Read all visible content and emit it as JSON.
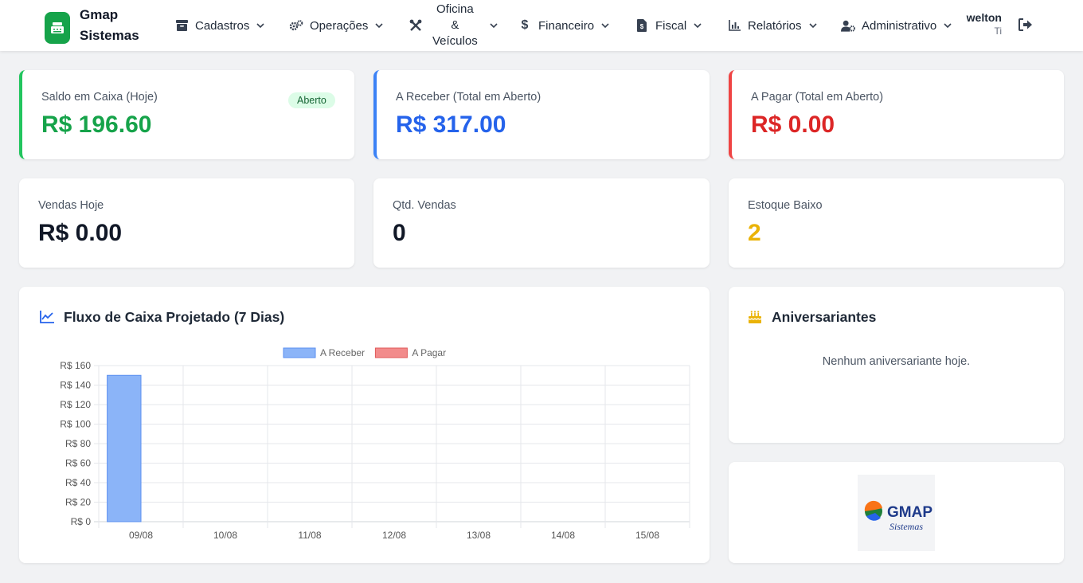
{
  "brand": {
    "name_line1": "Gmap",
    "name_line2": "Sistemas",
    "color": "#16a34a"
  },
  "nav": {
    "cadastros": "Cadastros",
    "operacoes": "Operações",
    "oficina_1": "Oficina",
    "oficina_2": "&",
    "oficina_3": "Veículos",
    "financeiro": "Financeiro",
    "fiscal": "Fiscal",
    "relatorios": "Relatórios",
    "administrativo": "Administrativo"
  },
  "user": {
    "name": "welton",
    "role": "Ti"
  },
  "stats_top": {
    "saldo": {
      "label": "Saldo em Caixa (Hoje)",
      "value": "R$ 196.60",
      "badge": "Aberto",
      "color": "#16a34a"
    },
    "receber": {
      "label": "A Receber (Total em Aberto)",
      "value": "R$ 317.00",
      "color": "#2563eb"
    },
    "pagar": {
      "label": "A Pagar (Total em Aberto)",
      "value": "R$ 0.00",
      "color": "#dc2626"
    }
  },
  "stats_bottom": {
    "vendas_hoje": {
      "label": "Vendas Hoje",
      "value": "R$ 0.00"
    },
    "qtd_vendas": {
      "label": "Qtd. Vendas",
      "value": "0"
    },
    "estoque_baixo": {
      "label": "Estoque Baixo",
      "value": "2",
      "color": "#eab308"
    }
  },
  "fluxo": {
    "title": "Fluxo de Caixa Projetado (7 Dias)"
  },
  "aniversariantes": {
    "title": "Aniversariantes",
    "empty": "Nenhum aniversariante hoje."
  },
  "logo_card": {
    "logo_text_1": "GMAP",
    "logo_text_2": "Sistemas"
  },
  "chart_data": {
    "type": "bar",
    "title": "",
    "xlabel": "",
    "ylabel": "",
    "categories": [
      "09/08",
      "10/08",
      "11/08",
      "12/08",
      "13/08",
      "14/08",
      "15/08"
    ],
    "series": [
      {
        "name": "A Receber",
        "values": [
          150,
          0,
          0,
          0,
          0,
          0,
          0
        ],
        "color": "#8bb4f8"
      },
      {
        "name": "A Pagar",
        "values": [
          0,
          0,
          0,
          0,
          0,
          0,
          0
        ],
        "color": "#f28b8b"
      }
    ],
    "ylim": [
      0,
      160
    ],
    "yticks": [
      "R$ 160",
      "R$ 140",
      "R$ 120",
      "R$ 100",
      "R$ 80",
      "R$ 60",
      "R$ 40",
      "R$ 20",
      "R$ 0"
    ],
    "grid": true,
    "legend": "top-center"
  }
}
